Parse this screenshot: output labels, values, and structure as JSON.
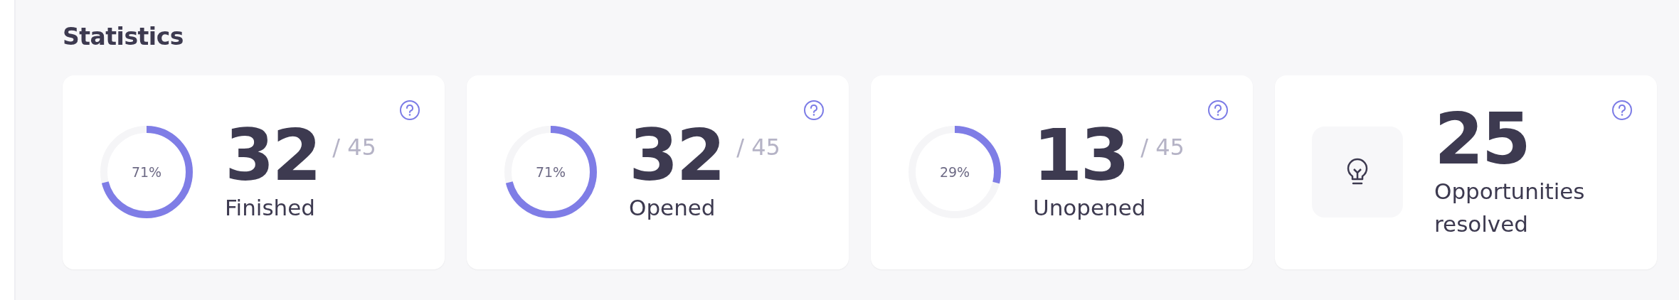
{
  "title": "Statistics",
  "cards": [
    {
      "kind": "ring",
      "percent": "71%",
      "value": "32",
      "total": "/ 45",
      "label": "Finished"
    },
    {
      "kind": "ring",
      "percent": "71%",
      "value": "32",
      "total": "/ 45",
      "label": "Opened"
    },
    {
      "kind": "ring",
      "percent": "29%",
      "value": "13",
      "total": "/ 45",
      "label": "Unopened"
    },
    {
      "kind": "icon",
      "value": "25",
      "label": "Opportunities resolved"
    }
  ]
}
